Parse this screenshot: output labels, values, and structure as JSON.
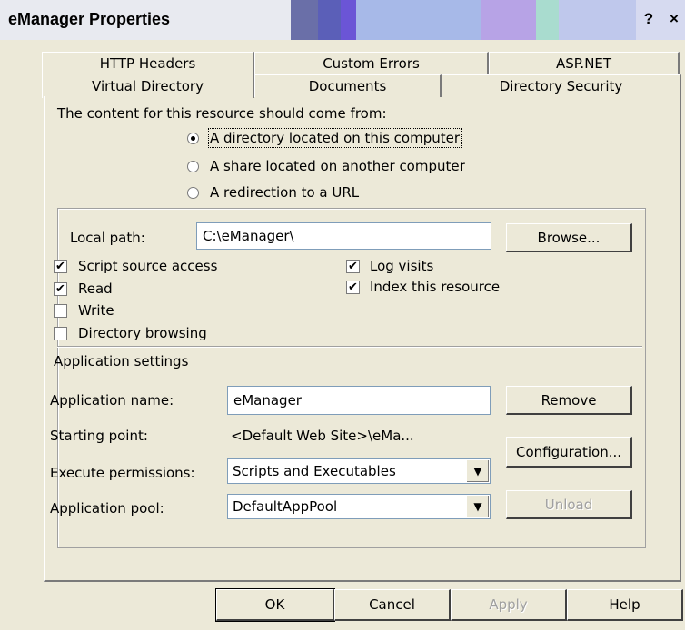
{
  "window": {
    "title": "eManager Properties",
    "help_label": "?",
    "close_label": "×"
  },
  "tabs": {
    "row1": [
      "HTTP Headers",
      "Custom Errors",
      "ASP.NET"
    ],
    "row2": [
      "Virtual Directory",
      "Documents",
      "Directory Security"
    ],
    "active": "Virtual Directory"
  },
  "content_source": {
    "heading": "The content for this resource should come from:",
    "options": [
      {
        "label": "A directory located on this computer",
        "selected": true
      },
      {
        "label": "A share located on another computer",
        "selected": false
      },
      {
        "label": "A redirection to a URL",
        "selected": false
      }
    ]
  },
  "local_path": {
    "label": "Local path:",
    "value": "C:\\eManager\\",
    "browse_label": "Browse..."
  },
  "checkboxes": {
    "left": [
      {
        "label": "Script source access",
        "checked": true
      },
      {
        "label": "Read",
        "checked": true
      },
      {
        "label": "Write",
        "checked": false
      },
      {
        "label": "Directory browsing",
        "checked": false
      }
    ],
    "right": [
      {
        "label": "Log visits",
        "checked": true
      },
      {
        "label": "Index this resource",
        "checked": true
      }
    ]
  },
  "app_settings": {
    "heading": "Application settings",
    "name_label": "Application name:",
    "name_value": "eManager",
    "remove_label": "Remove",
    "starting_point_label": "Starting point:",
    "starting_point_value": "<Default Web Site>\\eMa...",
    "configuration_label": "Configuration...",
    "execute_label": "Execute permissions:",
    "execute_value": "Scripts and Executables",
    "pool_label": "Application pool:",
    "pool_value": "DefaultAppPool",
    "unload_label": "Unload"
  },
  "footer": {
    "ok": "OK",
    "cancel": "Cancel",
    "apply": "Apply",
    "help": "Help"
  },
  "check_mark": "✔",
  "dropdown_arrow": "▼"
}
